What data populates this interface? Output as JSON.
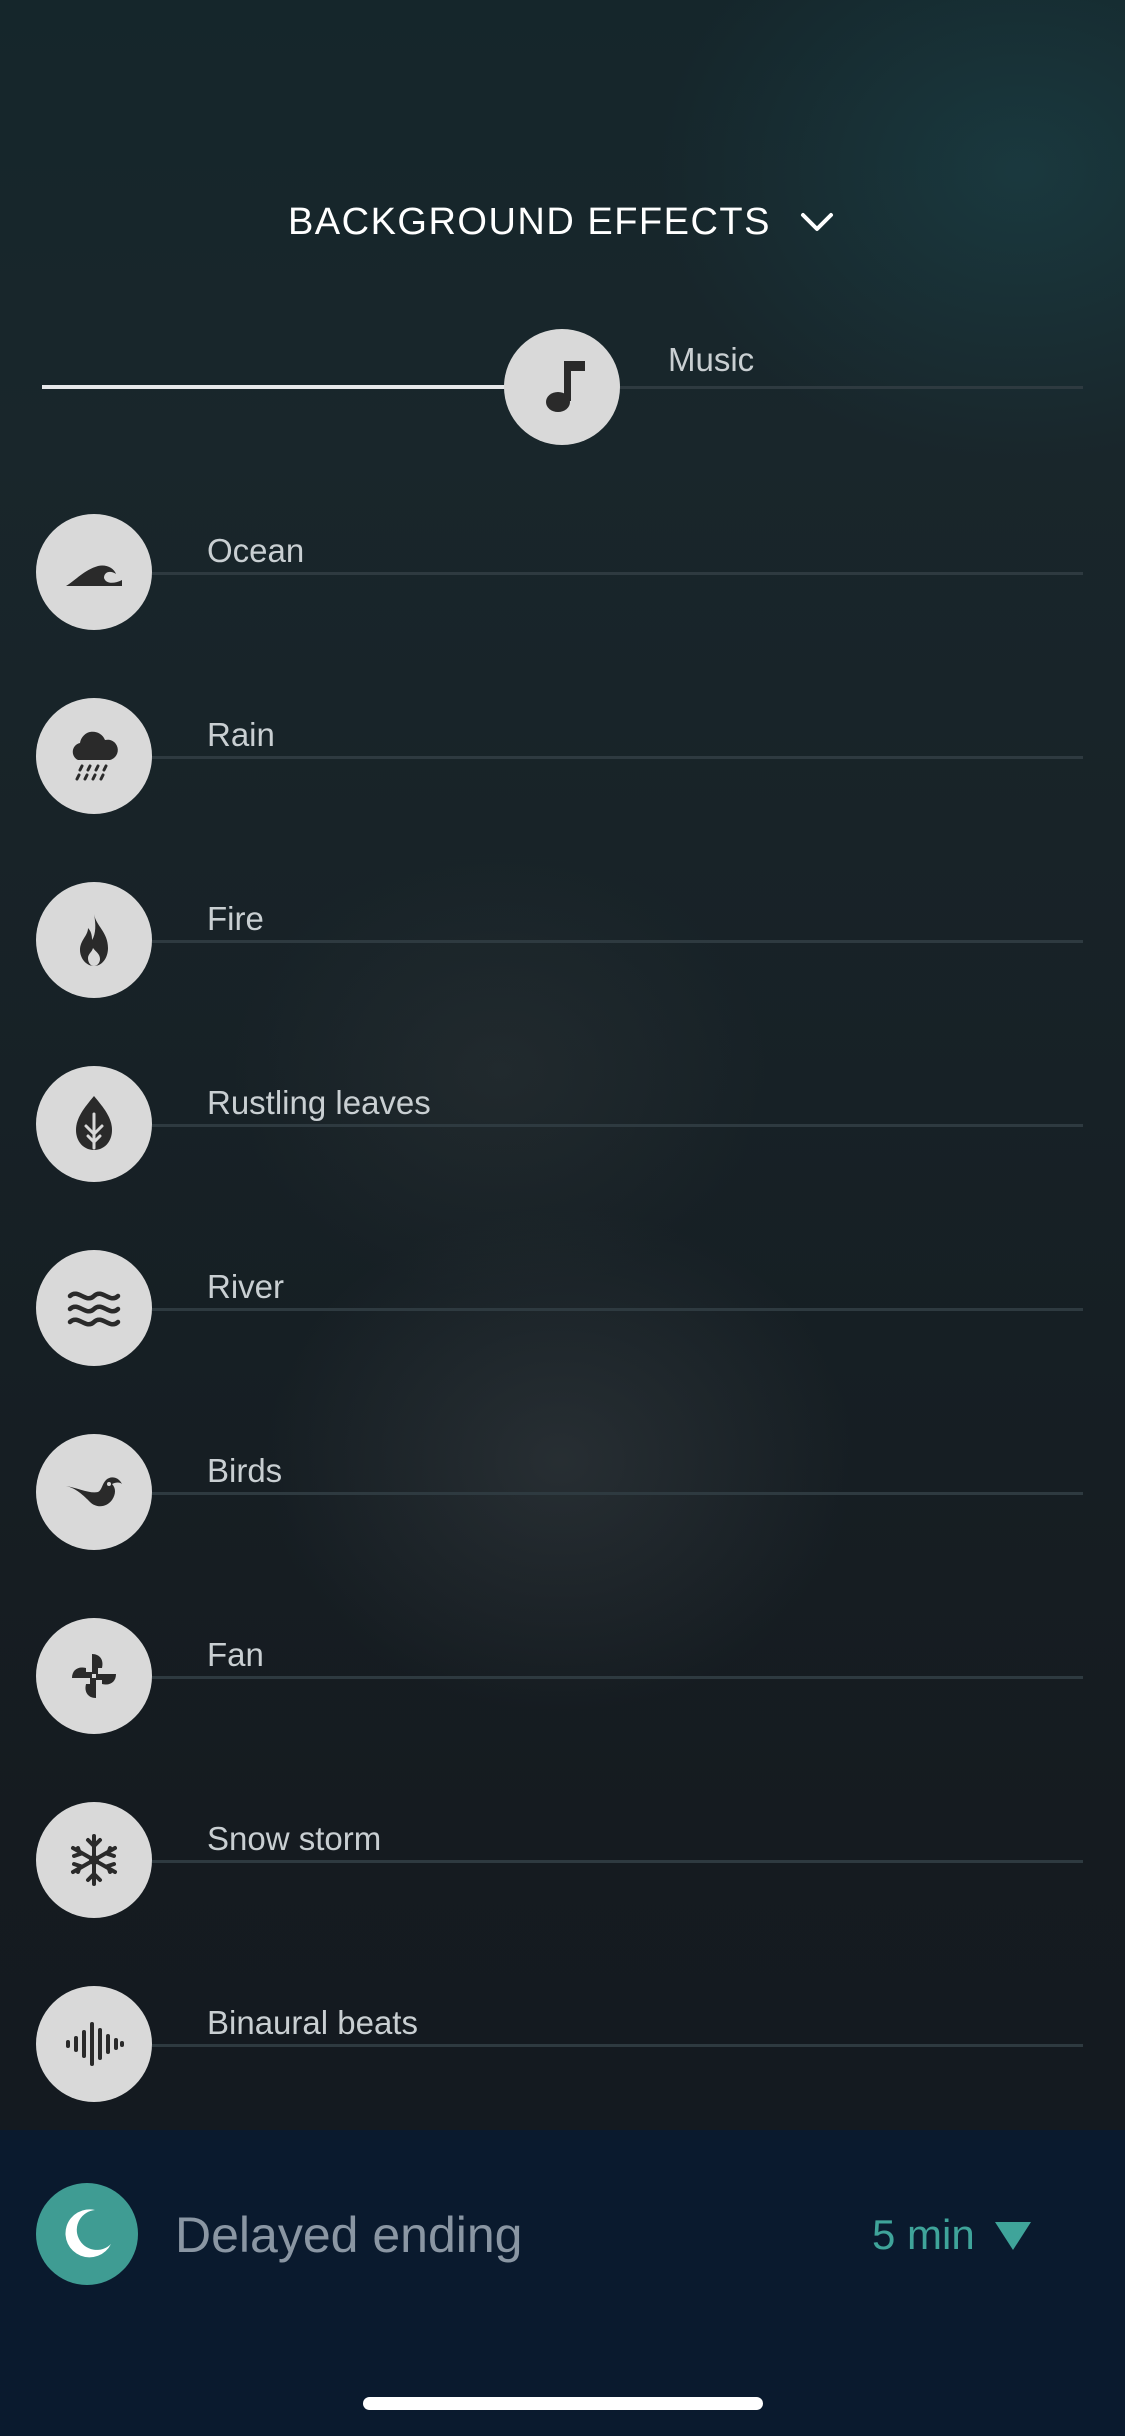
{
  "header": {
    "title": "BACKGROUND EFFECTS",
    "chevron_icon": "chevron-down-icon"
  },
  "music": {
    "label": "Music",
    "icon": "music-note-icon",
    "volume_fraction": 0.58
  },
  "effects": [
    {
      "label": "Ocean",
      "icon": "wave-icon"
    },
    {
      "label": "Rain",
      "icon": "rain-cloud-icon"
    },
    {
      "label": "Fire",
      "icon": "flame-icon"
    },
    {
      "label": "Rustling leaves",
      "icon": "leaf-icon"
    },
    {
      "label": "River",
      "icon": "water-waves-icon"
    },
    {
      "label": "Birds",
      "icon": "bird-icon"
    },
    {
      "label": "Fan",
      "icon": "fan-icon"
    },
    {
      "label": "Snow storm",
      "icon": "snowflake-icon"
    },
    {
      "label": "Binaural beats",
      "icon": "soundwave-icon"
    }
  ],
  "footer": {
    "label": "Delayed ending",
    "duration": "5 min",
    "moon_icon": "moon-icon",
    "dropdown_icon": "triangle-down-icon"
  },
  "colors": {
    "accent": "#3fa49a",
    "footer_bg": "#0a1a2e",
    "icon_circle": "#d9d9d9"
  }
}
